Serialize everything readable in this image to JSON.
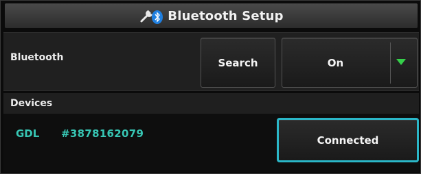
{
  "window": {
    "title": "Bluetooth Setup",
    "title_icon": "bluetooth-wrench-icon"
  },
  "bluetooth": {
    "label": "Bluetooth",
    "search_label": "Search",
    "state_value": "On",
    "dropdown_arrow_color": "#35d04a"
  },
  "devices": {
    "header": "Devices",
    "items": [
      {
        "name": "GDL",
        "id": "#3878162079",
        "status_button": "Connected"
      }
    ]
  },
  "colors": {
    "device_text": "#37c6b4",
    "selected_border": "#2bb7c8"
  }
}
